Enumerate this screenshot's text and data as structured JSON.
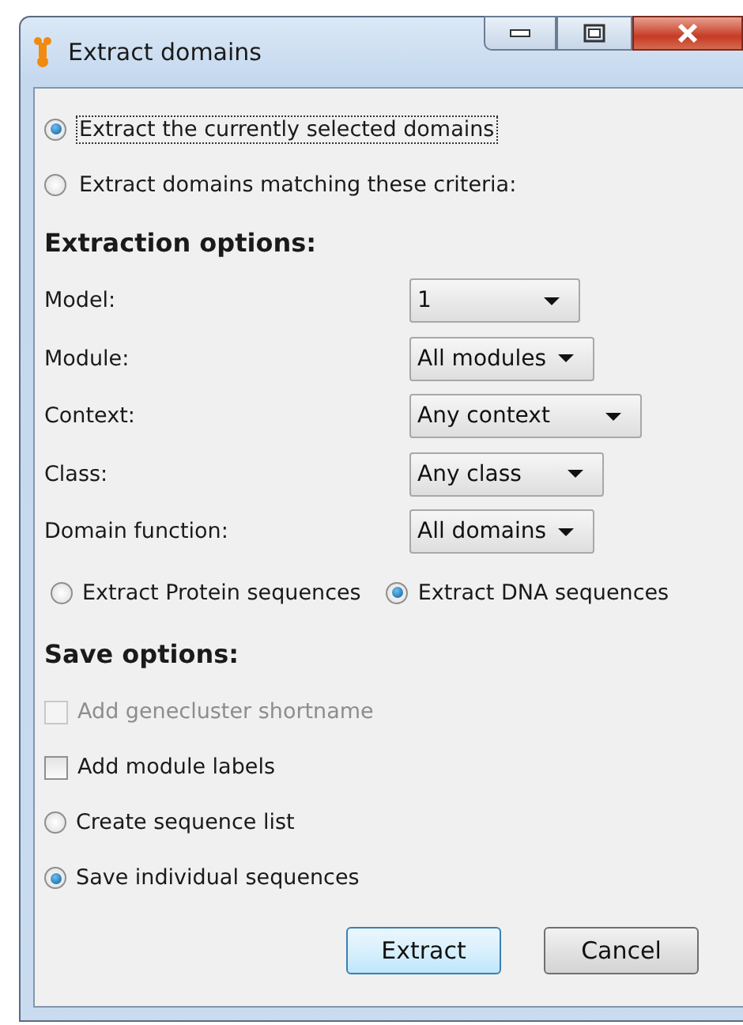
{
  "window": {
    "title": "Extract domains"
  },
  "selection": [
    {
      "label": "Extract the currently selected domains",
      "selected": true,
      "focused": true
    },
    {
      "label": "Extract domains matching these criteria:",
      "selected": false,
      "focused": false
    }
  ],
  "extraction_options": {
    "heading": "Extraction options:",
    "fields": [
      {
        "label": "Model:",
        "value": "1"
      },
      {
        "label": "Module:",
        "value": "All modules"
      },
      {
        "label": "Context:",
        "value": "Any context"
      },
      {
        "label": "Class:",
        "value": "Any class"
      },
      {
        "label": "Domain function:",
        "value": "All domains"
      }
    ],
    "sequence_type": [
      {
        "label": "Extract Protein sequences",
        "selected": false
      },
      {
        "label": "Extract DNA sequences",
        "selected": true
      }
    ]
  },
  "save_options": {
    "heading": "Save options:",
    "items": [
      {
        "kind": "checkbox",
        "label": "Add genecluster shortname",
        "checked": false,
        "disabled": true
      },
      {
        "kind": "checkbox",
        "label": "Add module labels",
        "checked": false,
        "disabled": false
      },
      {
        "kind": "radio",
        "label": "Create sequence list",
        "selected": false
      },
      {
        "kind": "radio",
        "label": "Save individual sequences",
        "selected": true
      }
    ]
  },
  "buttons": [
    {
      "label": "Extract",
      "default": true
    },
    {
      "label": "Cancel",
      "default": false
    }
  ]
}
